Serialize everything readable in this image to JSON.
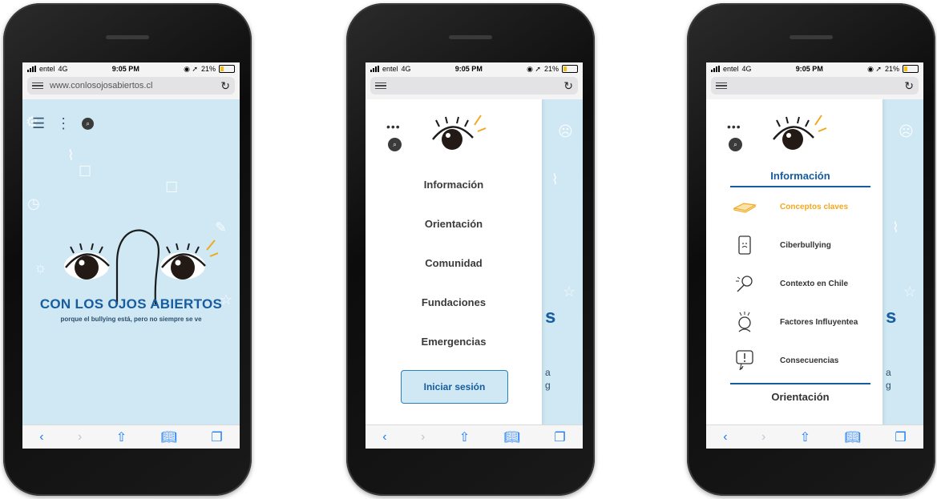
{
  "status": {
    "carrier": "entel",
    "network": "4G",
    "time": "9:05 PM",
    "battery": "21%"
  },
  "browser": {
    "url": "www.conlosojosabiertos.cl",
    "reload_icon": "reload-icon",
    "menu_icon": "reader-menu-icon"
  },
  "home": {
    "title": "CON LOS OJOS ABIERTOS",
    "subtitle": "porque el bullying está, pero no siempre se ve"
  },
  "drawer": {
    "items": [
      {
        "label": "Información"
      },
      {
        "label": "Orientación"
      },
      {
        "label": "Comunidad"
      },
      {
        "label": "Fundaciones"
      },
      {
        "label": "Emergencias"
      }
    ],
    "login_label": "Iniciar sesión",
    "peek_letters": [
      "s",
      "a",
      "g"
    ]
  },
  "submenu": {
    "section_title": "Información",
    "items": [
      {
        "label": "Conceptos claves",
        "icon": "book-icon",
        "active": true
      },
      {
        "label": "Ciberbullying",
        "icon": "phone-sad-icon",
        "active": false
      },
      {
        "label": "Contexto en Chile",
        "icon": "pin-icon",
        "active": false
      },
      {
        "label": "Factores Influyentea",
        "icon": "worried-face-icon",
        "active": false
      },
      {
        "label": "Consecuencias",
        "icon": "alert-bubble-icon",
        "active": false
      }
    ],
    "next_section": "Orientación"
  },
  "colors": {
    "accent": "#165c9e",
    "background": "#cfe8f3",
    "active_item": "#f2a81d",
    "ios_blue": "#1a7cf5"
  }
}
